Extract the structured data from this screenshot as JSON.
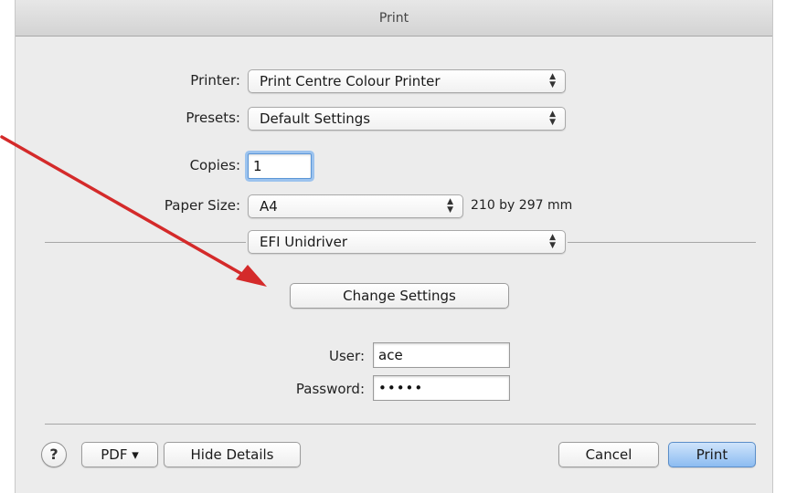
{
  "window": {
    "title": "Print"
  },
  "form": {
    "printer": {
      "label": "Printer:",
      "value": "Print Centre Colour Printer"
    },
    "presets": {
      "label": "Presets:",
      "value": "Default Settings"
    },
    "copies": {
      "label": "Copies:",
      "value": "1"
    },
    "paper_size": {
      "label": "Paper Size:",
      "value": "A4",
      "dimensions": "210 by 297 mm"
    },
    "section": {
      "value": "EFI Unidriver"
    }
  },
  "driver": {
    "change_settings_label": "Change Settings",
    "user": {
      "label": "User:",
      "value": "ace"
    },
    "password": {
      "label": "Password:",
      "masked_value": "•••••"
    }
  },
  "footer": {
    "help_label": "?",
    "pdf_label": "PDF ▾",
    "hide_details_label": "Hide Details",
    "cancel_label": "Cancel",
    "print_label": "Print"
  },
  "icons": {
    "popup_arrows": "updown-chevron-icon",
    "help": "question-mark-icon",
    "annotation": "red-arrow-icon"
  },
  "colors": {
    "annotation_arrow": "#d42a2a",
    "default_button": "#8cbcf1",
    "focus_ring": "#9cc3ee"
  }
}
